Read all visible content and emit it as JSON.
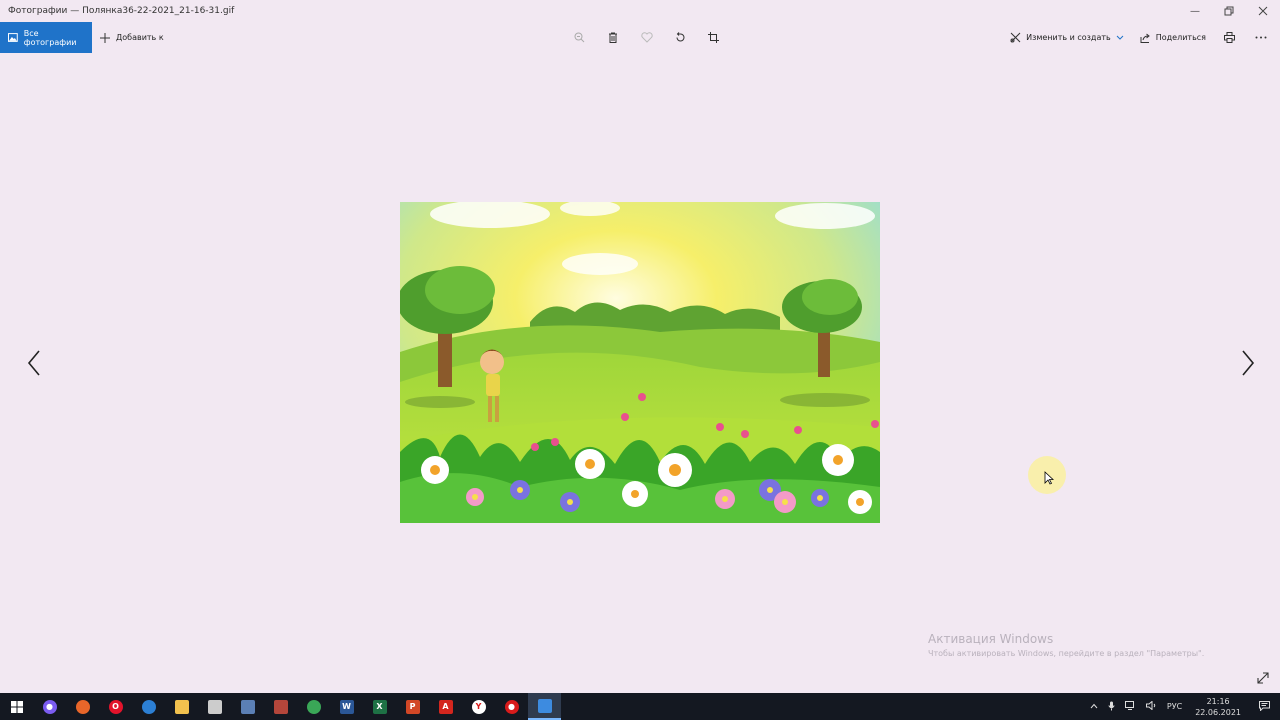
{
  "window": {
    "title": "Фотографии — Полянка36-22-2021_21-16-31.gif",
    "controls": [
      "minimize-icon",
      "restore-icon",
      "close-icon"
    ]
  },
  "toolbar": {
    "all_photos_label": "Все фотографии",
    "add_label": "Добавить к",
    "center_icons": [
      "zoom-icon",
      "delete-icon",
      "favorite-icon",
      "rotate-icon",
      "crop-icon"
    ],
    "edit_create_label": "Изменить и создать",
    "share_label": "Поделиться",
    "right_icons": [
      "print-icon",
      "more-icon"
    ]
  },
  "activation": {
    "title": "Активация Windows",
    "subtitle": "Чтобы активировать Windows, перейдите в раздел \"Параметры\"."
  },
  "taskbar": {
    "apps": [
      {
        "name": "start",
        "color": "#ffffff",
        "glyph": "⊞"
      },
      {
        "name": "alice",
        "color": "#7b5cf0",
        "glyph": "●"
      },
      {
        "name": "firefox",
        "color": "#e8662a",
        "glyph": ""
      },
      {
        "name": "opera",
        "color": "#e3132b",
        "glyph": "O"
      },
      {
        "name": "edge",
        "color": "#2c7fd4",
        "glyph": ""
      },
      {
        "name": "explorer",
        "color": "#f2c14e",
        "glyph": ""
      },
      {
        "name": "clapper",
        "color": "#cccccc",
        "glyph": ""
      },
      {
        "name": "monitor",
        "color": "#5b7fb5",
        "glyph": ""
      },
      {
        "name": "winrar",
        "color": "#b4463b",
        "glyph": ""
      },
      {
        "name": "chrome",
        "color": "#3aa757",
        "glyph": ""
      },
      {
        "name": "word",
        "color": "#2b5797",
        "glyph": "W"
      },
      {
        "name": "excel",
        "color": "#1e7145",
        "glyph": "X"
      },
      {
        "name": "powerpoint",
        "color": "#d24726",
        "glyph": "P"
      },
      {
        "name": "acrobat",
        "color": "#d4261e",
        "glyph": "A"
      },
      {
        "name": "yandex",
        "color": "#ffffff",
        "glyph": "Y"
      },
      {
        "name": "recorder",
        "color": "#d81b1b",
        "glyph": "●"
      },
      {
        "name": "photos",
        "color": "#3d8be0",
        "glyph": ""
      }
    ],
    "tray": {
      "lang": "РУС",
      "time": "21:16",
      "date": "22.06.2021"
    }
  },
  "colors": {
    "background": "#f2e8f2",
    "accent": "#1f73c9",
    "taskbar": "#141821"
  }
}
